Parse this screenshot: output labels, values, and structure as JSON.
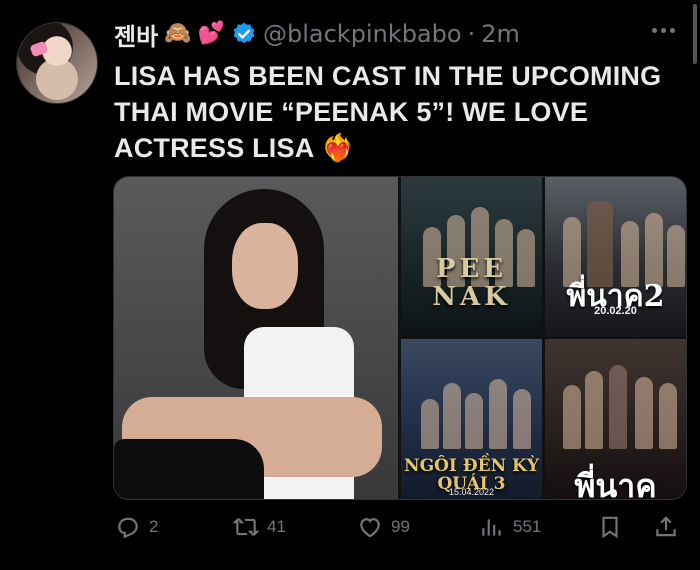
{
  "tweet": {
    "display_name": "젠바",
    "name_emojis": [
      "🙈",
      "💕"
    ],
    "handle": "@blackpinkbabo",
    "separator": "·",
    "time": "2m",
    "text": "LISA HAS BEEN CAST IN THE UPCOMING THAI MOVIE “PEENAK 5”! WE LOVE ACTRESS LISA ❤️‍🔥",
    "posters": [
      {
        "title": "PEE NAK",
        "date": ""
      },
      {
        "title": "พี่นาค2",
        "date": "20.02.20"
      },
      {
        "title": "NGÔI ĐỀN KỲ QUÁI 3",
        "date": "15.04.2022"
      },
      {
        "title": "พี่นาค",
        "date": ""
      }
    ]
  },
  "actions": {
    "reply_count": "2",
    "retweet_count": "41",
    "like_count": "99",
    "view_count": "551"
  },
  "colors": {
    "background": "#000000",
    "text": "#e7e9ea",
    "muted": "#71767b",
    "verified": "#1d9bf0"
  }
}
